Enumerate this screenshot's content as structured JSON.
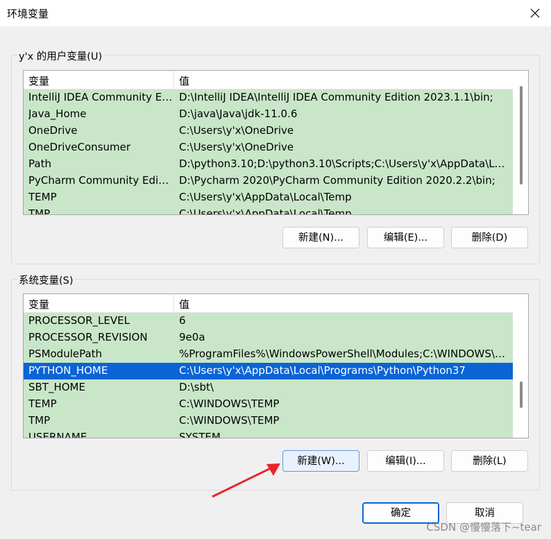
{
  "window": {
    "title": "环境变量"
  },
  "user_section": {
    "label": "y'x 的用户变量(U)",
    "columns": [
      "变量",
      "值"
    ],
    "rows": [
      {
        "name": "IntelliJ IDEA Community Ed...",
        "value": "D:\\IntelliJ IDEA\\IntelliJ IDEA Community Edition 2023.1.1\\bin;"
      },
      {
        "name": "Java_Home",
        "value": "D:\\java\\Java\\jdk-11.0.6"
      },
      {
        "name": "OneDrive",
        "value": "C:\\Users\\y'x\\OneDrive"
      },
      {
        "name": "OneDriveConsumer",
        "value": "C:\\Users\\y'x\\OneDrive"
      },
      {
        "name": "Path",
        "value": "D:\\python3.10;D:\\python3.10\\Scripts;C:\\Users\\y'x\\AppData\\Loc..."
      },
      {
        "name": "PyCharm Community Edition",
        "value": "D:\\Pycharm 2020\\PyCharm Community Edition 2020.2.2\\bin;"
      },
      {
        "name": "TEMP",
        "value": "C:\\Users\\y'x\\AppData\\Local\\Temp"
      },
      {
        "name": "TMP",
        "value": "C:\\Users\\y'x\\AppData\\Local\\Temp"
      }
    ],
    "buttons": {
      "new": "新建(N)...",
      "edit": "编辑(E)...",
      "delete": "删除(D)"
    }
  },
  "system_section": {
    "label": "系统变量(S)",
    "columns": [
      "变量",
      "值"
    ],
    "rows": [
      {
        "name": "PROCESSOR_LEVEL",
        "value": "6"
      },
      {
        "name": "PROCESSOR_REVISION",
        "value": "9e0a"
      },
      {
        "name": "PSModulePath",
        "value": "%ProgramFiles%\\WindowsPowerShell\\Modules;C:\\WINDOWS\\s..."
      },
      {
        "name": "PYTHON_HOME",
        "value": "C:\\Users\\y'x\\AppData\\Local\\Programs\\Python\\Python37"
      },
      {
        "name": "SBT_HOME",
        "value": "D:\\sbt\\"
      },
      {
        "name": "TEMP",
        "value": "C:\\WINDOWS\\TEMP"
      },
      {
        "name": "TMP",
        "value": "C:\\WINDOWS\\TEMP"
      },
      {
        "name": "USERNAME",
        "value": "SYSTEM"
      }
    ],
    "selected_index": 3,
    "buttons": {
      "new": "新建(W)...",
      "edit": "编辑(I)...",
      "delete": "删除(L)"
    }
  },
  "footer": {
    "ok": "确定",
    "cancel": "取消"
  },
  "watermark": "CSDN @慢慢落下~tear",
  "colors": {
    "row_bg": "#c9e6c9",
    "selected_bg": "#0a64d6",
    "arrow": "#e8262a"
  }
}
